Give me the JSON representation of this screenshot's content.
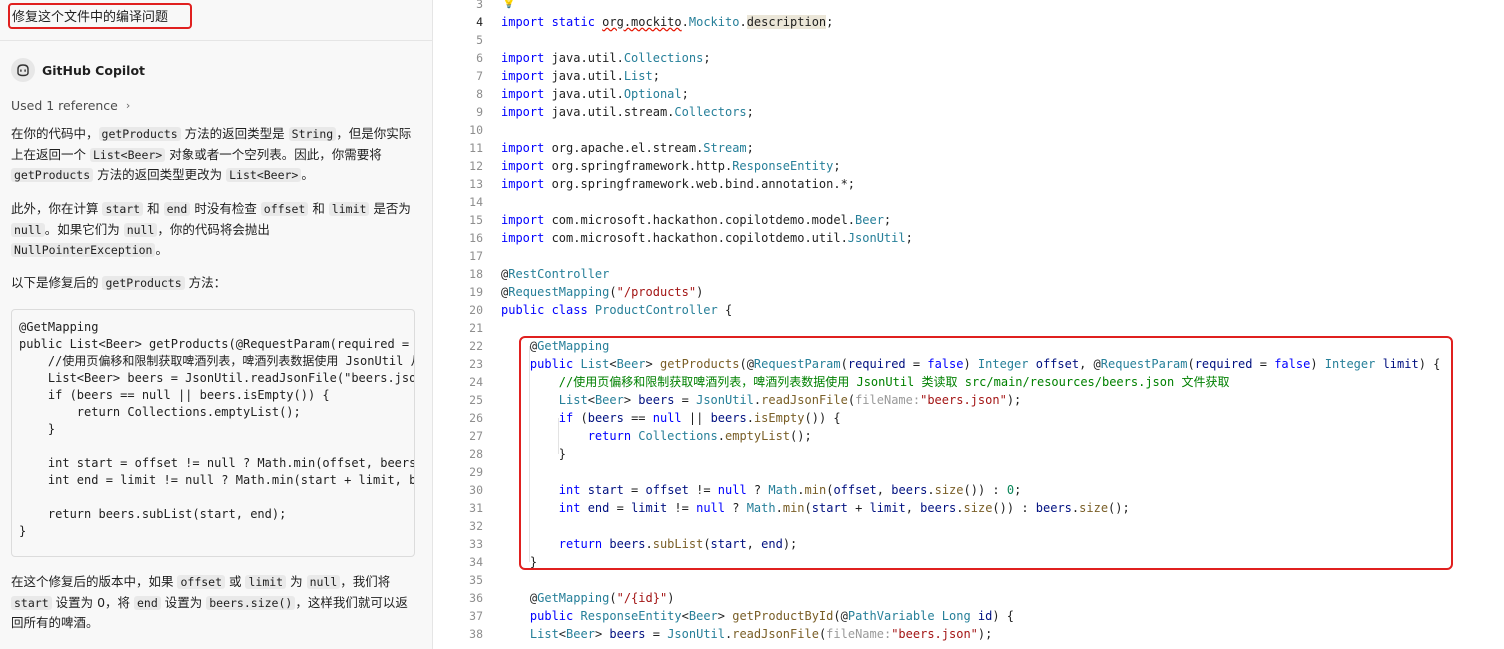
{
  "chat": {
    "prompt": "修复这个文件中的编译问题",
    "assistant_name": "GitHub Copilot",
    "references_label": "Used 1 reference",
    "para1": [
      [
        "t",
        "在你的代码中，"
      ],
      [
        "c",
        "getProducts"
      ],
      [
        "t",
        " 方法的返回类型是 "
      ],
      [
        "c",
        "String"
      ],
      [
        "t",
        "，但是你实际上在返回一个 "
      ],
      [
        "c",
        "List<Beer>"
      ],
      [
        "t",
        " 对象或者一个空列表。因此，你需要将 "
      ],
      [
        "c",
        "getProducts"
      ],
      [
        "t",
        " 方法的返回类型更改为 "
      ],
      [
        "c",
        "List<Beer>"
      ],
      [
        "t",
        "。"
      ]
    ],
    "para2": [
      [
        "t",
        "此外，你在计算 "
      ],
      [
        "c",
        "start"
      ],
      [
        "t",
        " 和 "
      ],
      [
        "c",
        "end"
      ],
      [
        "t",
        " 时没有检查 "
      ],
      [
        "c",
        "offset"
      ],
      [
        "t",
        " 和 "
      ],
      [
        "c",
        "limit"
      ],
      [
        "t",
        " 是否为 "
      ],
      [
        "c",
        "null"
      ],
      [
        "t",
        "。如果它们为 "
      ],
      [
        "c",
        "null"
      ],
      [
        "t",
        "，你的代码将会抛出 "
      ],
      [
        "c",
        "NullPointerException"
      ],
      [
        "t",
        "。"
      ]
    ],
    "para3": [
      [
        "t",
        "以下是修复后的 "
      ],
      [
        "c",
        "getProducts"
      ],
      [
        "t",
        " 方法："
      ]
    ],
    "code_block": [
      "@GetMapping",
      "public List<Beer> getProducts(@RequestParam(required = ",
      "    //使用页偏移和限制获取啤酒列表，啤酒列表数据使用 JsonUtil 从",
      "    List<Beer> beers = JsonUtil.readJsonFile(\"beers.json",
      "    if (beers == null || beers.isEmpty()) {",
      "        return Collections.emptyList();",
      "    }",
      "",
      "    int start = offset != null ? Math.min(offset, beers",
      "    int end = limit != null ? Math.min(start + limit, b",
      "",
      "    return beers.subList(start, end);",
      "}"
    ],
    "para4": [
      [
        "t",
        "在这个修复后的版本中，如果 "
      ],
      [
        "c",
        "offset"
      ],
      [
        "t",
        " 或 "
      ],
      [
        "c",
        "limit"
      ],
      [
        "t",
        " 为 "
      ],
      [
        "c",
        "null"
      ],
      [
        "t",
        "，我们将 "
      ],
      [
        "c",
        "start"
      ],
      [
        "t",
        " 设置为 0，将 "
      ],
      [
        "c",
        "end"
      ],
      [
        "t",
        " 设置为 "
      ],
      [
        "c",
        "beers.size()"
      ],
      [
        "t",
        "，这样我们就可以返回所有的啤酒。"
      ]
    ]
  },
  "editor": {
    "active_line": 4,
    "lines": [
      {
        "n": 3,
        "tokens": []
      },
      {
        "n": 4,
        "tokens": [
          [
            "kw",
            "import static "
          ],
          [
            "squig",
            "org.mockito"
          ],
          [
            "",
            "."
          ],
          [
            "ty",
            "Mockito"
          ],
          [
            "",
            "."
          ],
          [
            "hl",
            "description"
          ],
          [
            "",
            ";"
          ]
        ]
      },
      {
        "n": 5,
        "tokens": []
      },
      {
        "n": 6,
        "tokens": [
          [
            "kw",
            "import "
          ],
          [
            "",
            "java.util."
          ],
          [
            "ty",
            "Collections"
          ],
          [
            "",
            ";"
          ]
        ]
      },
      {
        "n": 7,
        "tokens": [
          [
            "kw",
            "import "
          ],
          [
            "",
            "java.util."
          ],
          [
            "ty",
            "List"
          ],
          [
            "",
            ";"
          ]
        ]
      },
      {
        "n": 8,
        "tokens": [
          [
            "kw",
            "import "
          ],
          [
            "",
            "java.util."
          ],
          [
            "ty",
            "Optional"
          ],
          [
            "",
            ";"
          ]
        ]
      },
      {
        "n": 9,
        "tokens": [
          [
            "kw",
            "import "
          ],
          [
            "",
            "java.util.stream."
          ],
          [
            "ty",
            "Collectors"
          ],
          [
            "",
            ";"
          ]
        ]
      },
      {
        "n": 10,
        "tokens": []
      },
      {
        "n": 11,
        "tokens": [
          [
            "kw",
            "import "
          ],
          [
            "",
            "org.apache.el.stream."
          ],
          [
            "ty",
            "Stream"
          ],
          [
            "",
            ";"
          ]
        ]
      },
      {
        "n": 12,
        "tokens": [
          [
            "kw",
            "import "
          ],
          [
            "",
            "org.springframework.http."
          ],
          [
            "ty",
            "ResponseEntity"
          ],
          [
            "",
            ";"
          ]
        ]
      },
      {
        "n": 13,
        "tokens": [
          [
            "kw",
            "import "
          ],
          [
            "",
            "org.springframework.web.bind.annotation.*;"
          ]
        ]
      },
      {
        "n": 14,
        "tokens": []
      },
      {
        "n": 15,
        "tokens": [
          [
            "kw",
            "import "
          ],
          [
            "",
            "com.microsoft.hackathon.copilotdemo.model."
          ],
          [
            "ty",
            "Beer"
          ],
          [
            "",
            ";"
          ]
        ]
      },
      {
        "n": 16,
        "tokens": [
          [
            "kw",
            "import "
          ],
          [
            "",
            "com.microsoft.hackathon.copilotdemo.util."
          ],
          [
            "ty",
            "JsonUtil"
          ],
          [
            "",
            ";"
          ]
        ]
      },
      {
        "n": 17,
        "tokens": []
      },
      {
        "n": 18,
        "tokens": [
          [
            "",
            "@"
          ],
          [
            "an",
            "RestController"
          ]
        ]
      },
      {
        "n": 19,
        "tokens": [
          [
            "",
            "@"
          ],
          [
            "an",
            "RequestMapping"
          ],
          [
            "",
            "("
          ],
          [
            "st",
            "\"/products\""
          ],
          [
            "",
            ")"
          ]
        ]
      },
      {
        "n": 20,
        "tokens": [
          [
            "kw",
            "public class "
          ],
          [
            "ty",
            "ProductController"
          ],
          [
            "",
            " {"
          ]
        ]
      },
      {
        "n": 21,
        "tokens": []
      },
      {
        "n": 22,
        "tokens": [
          [
            "",
            "    @"
          ],
          [
            "an",
            "GetMapping"
          ]
        ]
      },
      {
        "n": 23,
        "tokens": [
          [
            "kw",
            "    public "
          ],
          [
            "ty",
            "List"
          ],
          [
            "",
            "<"
          ],
          [
            "ty",
            "Beer"
          ],
          [
            "",
            "> "
          ],
          [
            "fn",
            "getProducts"
          ],
          [
            "",
            "(@"
          ],
          [
            "an",
            "RequestParam"
          ],
          [
            "",
            "("
          ],
          [
            "va",
            "required"
          ],
          [
            "",
            " = "
          ],
          [
            "kw",
            "false"
          ],
          [
            "",
            ") "
          ],
          [
            "ty",
            "Integer "
          ],
          [
            "va",
            "offset"
          ],
          [
            "",
            ", @"
          ],
          [
            "an",
            "RequestParam"
          ],
          [
            "",
            "("
          ],
          [
            "va",
            "required"
          ],
          [
            "",
            " = "
          ],
          [
            "kw",
            "false"
          ],
          [
            "",
            ") "
          ],
          [
            "ty",
            "Integer "
          ],
          [
            "va",
            "limit"
          ],
          [
            "",
            ") {"
          ]
        ]
      },
      {
        "n": 24,
        "tokens": [
          [
            "cm",
            "        //使用页偏移和限制获取啤酒列表，啤酒列表数据使用 JsonUtil 类读取 src/main/resources/beers.json 文件获取"
          ]
        ]
      },
      {
        "n": 25,
        "tokens": [
          [
            "ty",
            "        List"
          ],
          [
            "",
            "<"
          ],
          [
            "ty",
            "Beer"
          ],
          [
            "",
            "> "
          ],
          [
            "va",
            "beers"
          ],
          [
            "",
            " = "
          ],
          [
            "ty",
            "JsonUtil"
          ],
          [
            "",
            "."
          ],
          [
            "fn",
            "readJsonFile"
          ],
          [
            "",
            "("
          ],
          [
            "hint",
            "fileName:"
          ],
          [
            "st",
            "\"beers.json\""
          ],
          [
            "",
            ");"
          ]
        ]
      },
      {
        "n": 26,
        "tokens": [
          [
            "kw",
            "        if "
          ],
          [
            "",
            "("
          ],
          [
            "va",
            "beers"
          ],
          [
            "",
            " == "
          ],
          [
            "kw",
            "null"
          ],
          [
            "",
            " || "
          ],
          [
            "va",
            "beers"
          ],
          [
            "",
            "."
          ],
          [
            "fn",
            "isEmpty"
          ],
          [
            "",
            "()) {"
          ]
        ]
      },
      {
        "n": 27,
        "tokens": [
          [
            "kw",
            "            return "
          ],
          [
            "ty",
            "Collections"
          ],
          [
            "",
            "."
          ],
          [
            "fn",
            "emptyList"
          ],
          [
            "",
            "();"
          ]
        ]
      },
      {
        "n": 28,
        "tokens": [
          [
            "",
            "        }"
          ]
        ]
      },
      {
        "n": 29,
        "tokens": []
      },
      {
        "n": 30,
        "tokens": [
          [
            "kw",
            "        int "
          ],
          [
            "va",
            "start"
          ],
          [
            "",
            " = "
          ],
          [
            "va",
            "offset"
          ],
          [
            "",
            " != "
          ],
          [
            "kw",
            "null"
          ],
          [
            "",
            " ? "
          ],
          [
            "ty",
            "Math"
          ],
          [
            "",
            "."
          ],
          [
            "fn",
            "min"
          ],
          [
            "",
            "("
          ],
          [
            "va",
            "offset"
          ],
          [
            "",
            ", "
          ],
          [
            "va",
            "beers"
          ],
          [
            "",
            "."
          ],
          [
            "fn",
            "size"
          ],
          [
            "",
            "()) : "
          ],
          [
            "nm",
            "0"
          ],
          [
            "",
            ";"
          ]
        ]
      },
      {
        "n": 31,
        "tokens": [
          [
            "kw",
            "        int "
          ],
          [
            "va",
            "end"
          ],
          [
            "",
            " = "
          ],
          [
            "va",
            "limit"
          ],
          [
            "",
            " != "
          ],
          [
            "kw",
            "null"
          ],
          [
            "",
            " ? "
          ],
          [
            "ty",
            "Math"
          ],
          [
            "",
            "."
          ],
          [
            "fn",
            "min"
          ],
          [
            "",
            "("
          ],
          [
            "va",
            "start"
          ],
          [
            "",
            " + "
          ],
          [
            "va",
            "limit"
          ],
          [
            "",
            ", "
          ],
          [
            "va",
            "beers"
          ],
          [
            "",
            "."
          ],
          [
            "fn",
            "size"
          ],
          [
            "",
            "()) : "
          ],
          [
            "va",
            "beers"
          ],
          [
            "",
            "."
          ],
          [
            "fn",
            "size"
          ],
          [
            "",
            "();"
          ]
        ]
      },
      {
        "n": 32,
        "tokens": []
      },
      {
        "n": 33,
        "tokens": [
          [
            "kw",
            "        return "
          ],
          [
            "va",
            "beers"
          ],
          [
            "",
            "."
          ],
          [
            "fn",
            "subList"
          ],
          [
            "",
            "("
          ],
          [
            "va",
            "start"
          ],
          [
            "",
            ", "
          ],
          [
            "va",
            "end"
          ],
          [
            "",
            ");"
          ]
        ]
      },
      {
        "n": 34,
        "tokens": [
          [
            "",
            "    }"
          ]
        ]
      },
      {
        "n": 35,
        "tokens": []
      },
      {
        "n": 36,
        "tokens": [
          [
            "",
            "    @"
          ],
          [
            "an",
            "GetMapping"
          ],
          [
            "",
            "("
          ],
          [
            "st",
            "\"/{id}\""
          ],
          [
            "",
            ")"
          ]
        ]
      },
      {
        "n": 37,
        "tokens": [
          [
            "kw",
            "    public "
          ],
          [
            "ty",
            "ResponseEntity"
          ],
          [
            "",
            "<"
          ],
          [
            "ty",
            "Beer"
          ],
          [
            "",
            "> "
          ],
          [
            "fn",
            "getProductById"
          ],
          [
            "",
            "(@"
          ],
          [
            "an",
            "PathVariable "
          ],
          [
            "ty",
            "Long "
          ],
          [
            "va",
            "id"
          ],
          [
            "",
            ") {"
          ]
        ]
      },
      {
        "n": 38,
        "tokens": [
          [
            "ty",
            "    List"
          ],
          [
            "",
            "<"
          ],
          [
            "ty",
            "Beer"
          ],
          [
            "",
            "> "
          ],
          [
            "va",
            "beers"
          ],
          [
            "",
            " = "
          ],
          [
            "ty",
            "JsonUtil"
          ],
          [
            "",
            "."
          ],
          [
            "fn",
            "readJsonFile"
          ],
          [
            "",
            "("
          ],
          [
            "hint",
            "fileName:"
          ],
          [
            "st",
            "\"beers.json\""
          ],
          [
            "",
            ");"
          ]
        ]
      }
    ]
  },
  "colors": {
    "annotation_box": "#e0201f",
    "keyword": "#0000ff",
    "type": "#267f99",
    "function": "#795e26",
    "string": "#a31515",
    "comment": "#008000"
  }
}
